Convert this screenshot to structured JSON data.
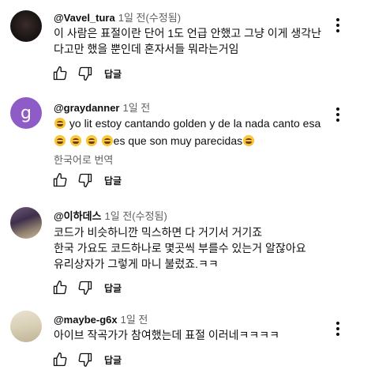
{
  "comments": [
    {
      "author": "@Vavel_tura",
      "time": "1일 전(수정됨)",
      "lines": [
        "이 사람은 표절이란 단어 1도 언급 안했고 그냥 이게 생각난",
        "다고만 했을 뿐인데 혼자서들 뭐라는거임"
      ],
      "reply_label": "답글"
    },
    {
      "author": "@graydanner",
      "time": "1일 전",
      "avatar_letter": "g",
      "line1": "yo lit estoy cantando golden y de la nada canto esa",
      "line2": "es que son muy parecidas",
      "translate_label": "한국어로 번역",
      "reply_label": "답글"
    },
    {
      "author": "@이하데스",
      "time": "1일 전(수정됨)",
      "lines": [
        "코드가 비슷하니깐 믹스하면  다 거기서 거기죠",
        "한국 가요도 코드하나로 몇곳씩 부를수 있는거 알잖아요",
        "유리상자가 그렇게 마니 불렀죠.ㅋㅋ"
      ],
      "reply_label": "답글"
    },
    {
      "author": "@maybe-g6x",
      "time": "1일 전",
      "lines": [
        "아이브 작곡가가 참여했는데 표절 이러네ㅋㅋㅋㅋ"
      ],
      "reply_label": "답글"
    }
  ],
  "colors": {
    "avatar_g": "#8e5cc6",
    "secondary_text": "#606060"
  },
  "icons": {
    "like": "thumbs-up-icon",
    "dislike": "thumbs-down-icon",
    "menu": "more-vert-icon",
    "emoji": "grinning-sweat-emoji"
  }
}
